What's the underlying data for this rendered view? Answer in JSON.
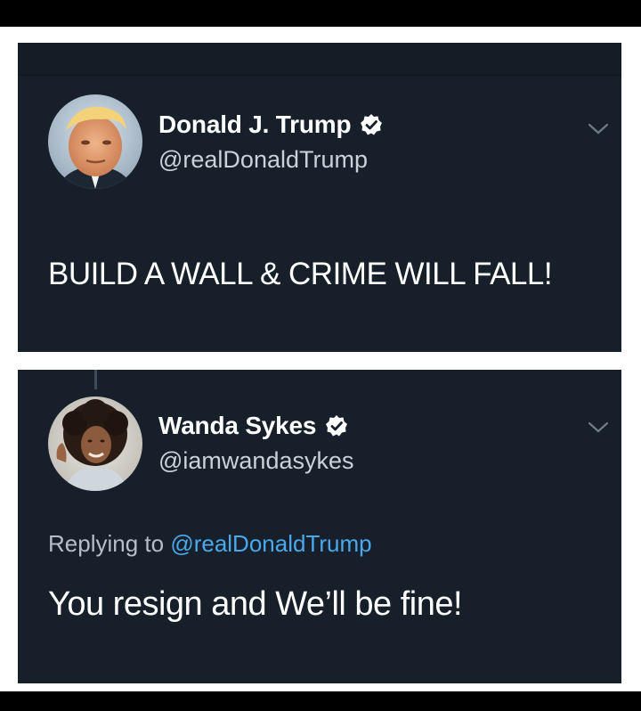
{
  "colors": {
    "card_background": "#17202a",
    "text_primary": "#ffffff",
    "text_secondary": "#c9d1d9",
    "link_blue": "#4aa8ec",
    "verified_badge": "#ffffff"
  },
  "tweets": [
    {
      "author_name": "Donald J. Trump",
      "handle": "@realDonaldTrump",
      "verified": true,
      "avatar_icon": "profile-photo-man",
      "text": "BUILD A WALL & CRIME WILL FALL!"
    },
    {
      "author_name": "Wanda Sykes",
      "handle": "@iamwandasykes",
      "verified": true,
      "avatar_icon": "profile-photo-woman",
      "replying_to_label": "Replying to",
      "replying_to_handle": "@realDonaldTrump",
      "text": "You resign and We’ll be fine!"
    }
  ]
}
